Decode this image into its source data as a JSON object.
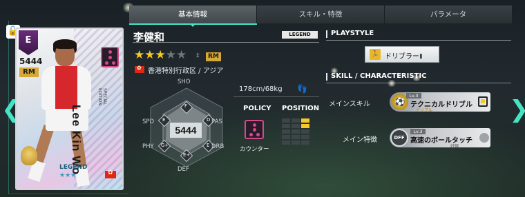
{
  "tabs": [
    {
      "label": "基本情報"
    },
    {
      "label": "スキル・特徴"
    },
    {
      "label": "パラメータ"
    }
  ],
  "card": {
    "badge_letter": "E",
    "overall": "5444",
    "position": "RM",
    "vertical_name": "Lee Kin Wo",
    "small_text": "SPECIAL EDITION",
    "legend_label": "LEGEND",
    "stars": "★★★"
  },
  "player": {
    "name": "李健和",
    "badge": "LEGEND",
    "stars_on": "★★★",
    "stars_off": "★★",
    "stars_sep": "‡",
    "position": "RM",
    "region": "香港特別行政区 / アジア",
    "height_weight": "178cm/68kg"
  },
  "hex": {
    "overall": "5444",
    "labels": {
      "sho": "SHO",
      "pas": "PAS",
      "drb": "DRB",
      "def": "DEF",
      "phy": "PHY",
      "spd": "SPD"
    },
    "grades": {
      "sho": "F",
      "pas": "D",
      "drb": "E",
      "def": "E",
      "phy": "G",
      "spd": "E"
    },
    "grade_mods": {
      "phy": "G+",
      "def": "E+"
    }
  },
  "policy": {
    "heading": "POLICY",
    "label": "カウンター"
  },
  "position_section": {
    "heading": "POSITION",
    "active_cells": [
      2,
      5
    ]
  },
  "right": {
    "playstyle_heading": "PLAYSTYLE",
    "playstyle_label": "ドリブラーⅡ",
    "skill_heading": "SKILL / CHARACTERISTIC",
    "main_skill_label": "メインスキル",
    "main_skill": {
      "level": "Lv.3",
      "name": "テクニカルドリブル",
      "category": "ドリブル"
    },
    "main_trait_label": "メイン特徴",
    "main_trait": {
      "icon": "DFF",
      "level": "Lv.3",
      "name": "高速のボールタッチ",
      "category": "好調"
    }
  },
  "colors": {
    "accent": "#46e3c4",
    "star": "#f5c926",
    "position_badge": "#d6a838",
    "policy_pink": "#d24c8c"
  }
}
